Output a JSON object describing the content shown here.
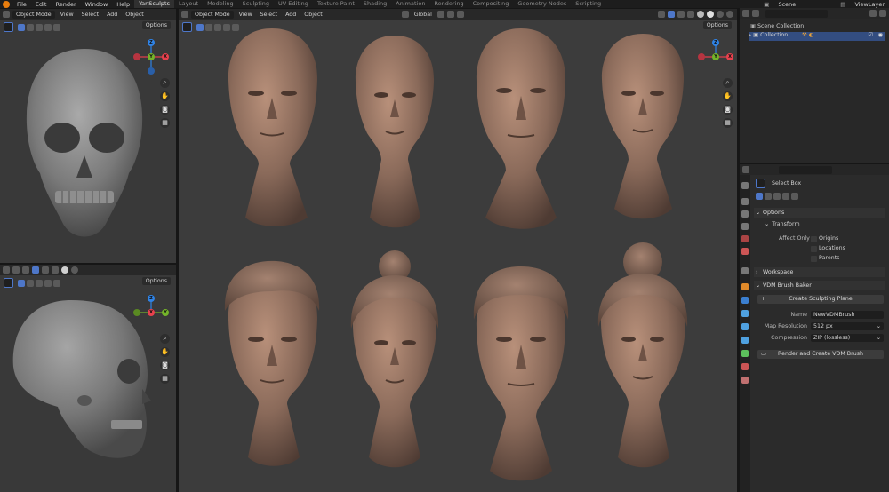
{
  "menu": [
    "File",
    "Edit",
    "Render",
    "Window",
    "Help"
  ],
  "workspaces": [
    "YanSculpts",
    "Layout",
    "Modeling",
    "Sculpting",
    "UV Editing",
    "Texture Paint",
    "Shading",
    "Animation",
    "Rendering",
    "Compositing",
    "Geometry Nodes",
    "Scripting"
  ],
  "active_workspace": "YanSculpts",
  "scene": "Scene",
  "view_layer": "ViewLayer",
  "viewport_left_top": {
    "mode": "Object Mode",
    "menus": [
      "View",
      "Select",
      "Add",
      "Object"
    ],
    "options": "Options"
  },
  "viewport_main": {
    "mode": "Object Mode",
    "menus": [
      "View",
      "Select",
      "Add",
      "Object"
    ],
    "options": "Options",
    "transform_orientation": "Global"
  },
  "viewport_left_bottom": {
    "options": "Options"
  },
  "gizmo": {
    "x_color": "#e8414d",
    "y_color": "#74b32a",
    "z_color": "#2f83e6",
    "x": "X",
    "y": "Y",
    "z": "Z"
  },
  "outliner": {
    "root": "Scene Collection",
    "child": "Collection"
  },
  "properties": {
    "tool": "Select Box",
    "options_title": "Options",
    "transform_title": "Transform",
    "affect_only_label": "Affect Only",
    "affect_options": [
      "Origins",
      "Locations",
      "Parents"
    ],
    "workspace_title": "Workspace",
    "vdm_title": "VDM Brush Baker",
    "create_plane_btn": "Create Sculpting Plane",
    "name_label": "Name",
    "name_value": "NewVDMBrush",
    "map_res_label": "Map Resolution",
    "map_res_value": "512 px",
    "compression_label": "Compression",
    "compression_value": "ZIP (lossless)",
    "render_btn": "Render and Create VDM Brush"
  }
}
